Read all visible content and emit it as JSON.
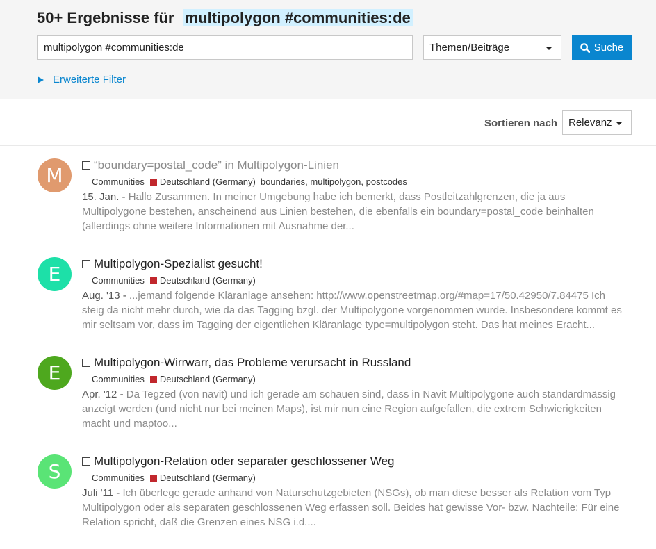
{
  "header": {
    "count_prefix": "50+ Ergebnisse für",
    "search_term": "multipolygon #communities:de"
  },
  "search": {
    "value": "multipolygon #communities:de",
    "type_selected": "Themen/Beiträge",
    "button_label": "Suche",
    "advanced_filters_label": "Erweiterte Filter"
  },
  "sort": {
    "label": "Sortieren nach",
    "selected": "Relevanz"
  },
  "results": [
    {
      "avatar_letter": "M",
      "avatar_color": "#e09a6e",
      "title": "“boundary=postal_code” in Multipolygon-Linien",
      "visited": true,
      "category_parent": "Communities",
      "category": "Deutschland (Germany)",
      "tags": "boundaries, multipolygon, postcodes",
      "date": "15. Jan. -",
      "excerpt": "Hallo Zusammen. In meiner Umgebung habe ich bemerkt, dass Postleitzahlgrenzen, die ja aus Multipolygone bestehen, anscheinend aus Linien bestehen, die ebenfalls ein boundary=postal_code beinhalten (allerdings ohne weitere Informationen mit Ausnahme der..."
    },
    {
      "avatar_letter": "E",
      "avatar_color": "#1de0a8",
      "title": "Multipolygon-Spezialist gesucht!",
      "visited": false,
      "category_parent": "Communities",
      "category": "Deutschland (Germany)",
      "tags": "",
      "date": "Aug. '13 -",
      "excerpt": "...jemand folgende Kläranlage ansehen: http://www.openstreetmap.org/#map=17/50.42950/7.84475 Ich steig da nicht mehr durch, wie da das Tagging bzgl. der Multipolygone vorgenommen wurde. Insbesondere kommt es mir seltsam vor, dass im Tagging der eigentlichen Kläranlage type=multipolygon steht. Das hat meines Eracht..."
    },
    {
      "avatar_letter": "E",
      "avatar_color": "#4ea81e",
      "title": "Multipolygon-Wirrwarr, das Probleme verursacht in Russland",
      "visited": false,
      "category_parent": "Communities",
      "category": "Deutschland (Germany)",
      "tags": "",
      "date": "Apr. '12 -",
      "excerpt": "Da Tegzed (von navit) und ich gerade am schauen sind, dass in Navit Multipolygone auch standardmässig anzeigt werden (und nicht nur bei meinen Maps), ist mir nun eine Region aufgefallen, die extrem Schwierigkeiten macht und maptoo..."
    },
    {
      "avatar_letter": "S",
      "avatar_color": "#5ae476",
      "title": "Multipolygon-Relation oder separater geschlossener Weg",
      "visited": false,
      "category_parent": "Communities",
      "category": "Deutschland (Germany)",
      "tags": "",
      "date": "Juli '11 -",
      "excerpt": "Ich überlege gerade anhand von Naturschutzgebieten (NSGs), ob man diese besser als Relation vom Typ Multipolygon oder als separaten geschlossenen Weg erfassen soll. Beides hat gewisse Vor- bzw. Nachteile: Für eine Relation spricht, daß die Grenzen eines NSG i.d...."
    }
  ]
}
